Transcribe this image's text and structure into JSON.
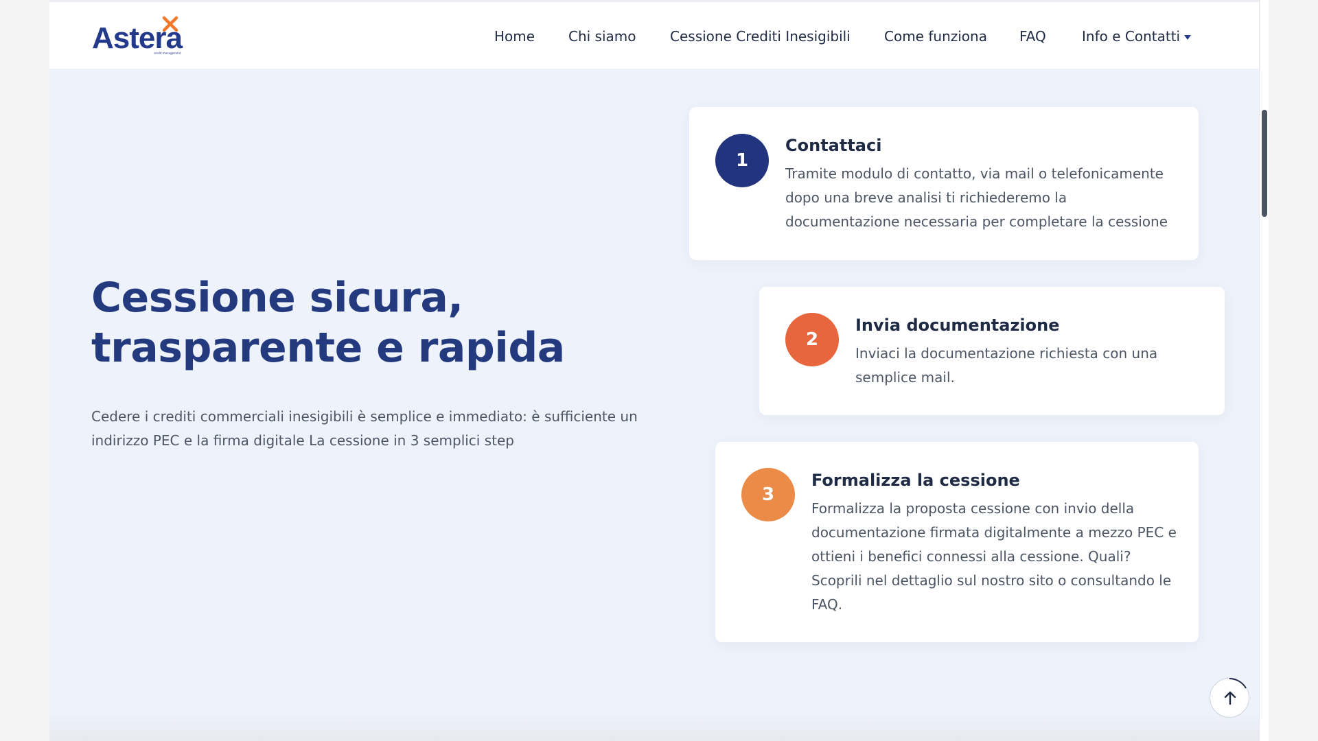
{
  "brand": {
    "logo_text": "Astera",
    "tagline": "credit management",
    "colors": {
      "primary": "#233a8a",
      "accent_orange": "#f2782a"
    }
  },
  "nav": {
    "items": [
      {
        "label": "Home"
      },
      {
        "label": "Chi siamo"
      },
      {
        "label": "Cessione Crediti Inesigibili"
      },
      {
        "label": "Come funziona"
      },
      {
        "label": "FAQ"
      },
      {
        "label": "Info e Contatti",
        "has_dropdown": true
      }
    ]
  },
  "hero": {
    "title_line1": "Cessione sicura,",
    "title_line2": "trasparente e rapida",
    "description": "Cedere i crediti commerciali inesigibili è semplice e immediato: è sufficiente un indirizzo PEC e la firma digitale La cessione in 3 semplici step"
  },
  "steps": [
    {
      "number": "1",
      "title": "Contattaci",
      "text": "Tramite modulo di contatto, via mail o telefonicamente dopo una breve analisi ti richiederemo la documentazione necessaria per completare la cessione",
      "color": "#23347f"
    },
    {
      "number": "2",
      "title": "Invia documentazione",
      "text": "Inviaci la documentazione richiesta con una semplice mail.",
      "color": "#e8663d"
    },
    {
      "number": "3",
      "title": "Formalizza la cessione",
      "text": "Formalizza la proposta cessione con invio della documentazione firmata digitalmente a mezzo PEC e ottieni i benefici connessi alla cessione. Quali? Scoprili nel dettaglio sul nostro sito o consultando le FAQ.",
      "color": "#ec8a48"
    }
  ],
  "icons": {
    "scroll_top": "arrow-up-icon",
    "logo_mark": "x-mark-icon",
    "dropdown": "caret-down-icon"
  }
}
